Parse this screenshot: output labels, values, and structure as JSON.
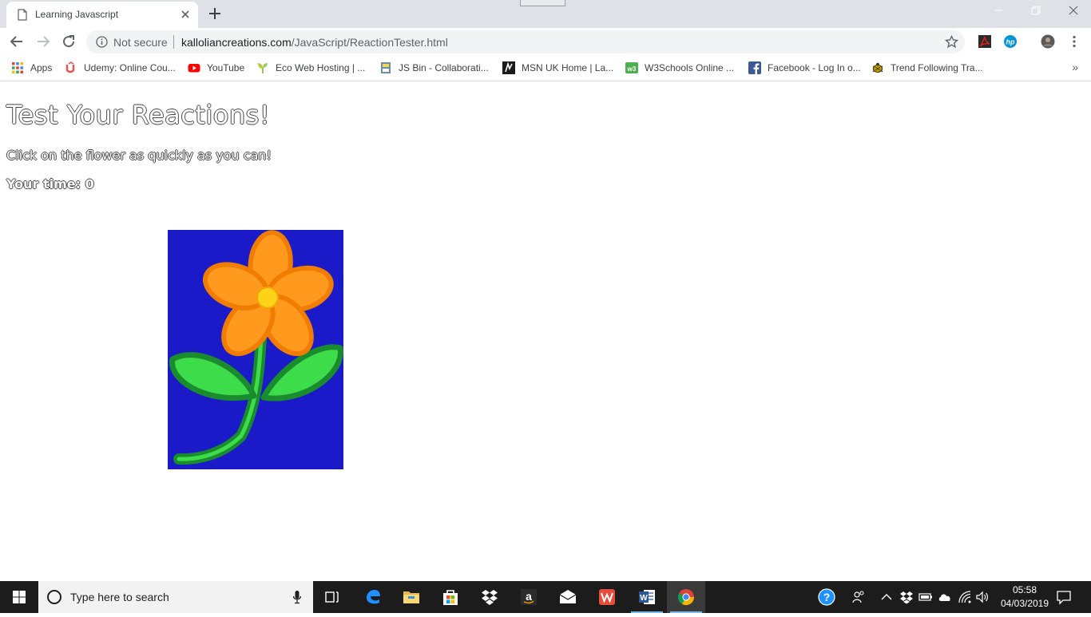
{
  "browser": {
    "tab": {
      "title": "Learning Javascript"
    },
    "omnibox": {
      "security_text": "Not secure",
      "url_host": "kalloliancreations.com",
      "url_path": "/JavaScript/ReactionTester.html"
    },
    "bookmarks": [
      {
        "label": "Apps",
        "icon": "apps-grid-icon"
      },
      {
        "label": "Udemy: Online Cou...",
        "icon": "udemy-icon"
      },
      {
        "label": "YouTube",
        "icon": "youtube-icon"
      },
      {
        "label": "Eco Web Hosting | ...",
        "icon": "eco-leaf-icon"
      },
      {
        "label": "JS Bin - Collaborati...",
        "icon": "jsbin-icon"
      },
      {
        "label": "MSN UK Home | La...",
        "icon": "msn-icon"
      },
      {
        "label": "W3Schools Online ...",
        "icon": "w3schools-icon"
      },
      {
        "label": "Facebook - Log In o...",
        "icon": "facebook-icon"
      },
      {
        "label": "Trend Following Tra...",
        "icon": "turtle-icon"
      }
    ],
    "bookmarks_more": "»"
  },
  "page": {
    "title": "Test Your Reactions!",
    "instruction": "Click on the flower as quickly as you can!",
    "time_label": "Your time: 0"
  },
  "flower": {
    "background": "#1a1ac8",
    "petal_fill": "#ff9a1f",
    "petal_stroke": "#f07c00",
    "center": "#ffd21a",
    "leaf_fill": "#3ddc4a",
    "leaf_stroke": "#1a8c2e"
  },
  "taskbar": {
    "search_placeholder": "Type here to search",
    "time": "05:58",
    "date": "04/03/2019"
  }
}
